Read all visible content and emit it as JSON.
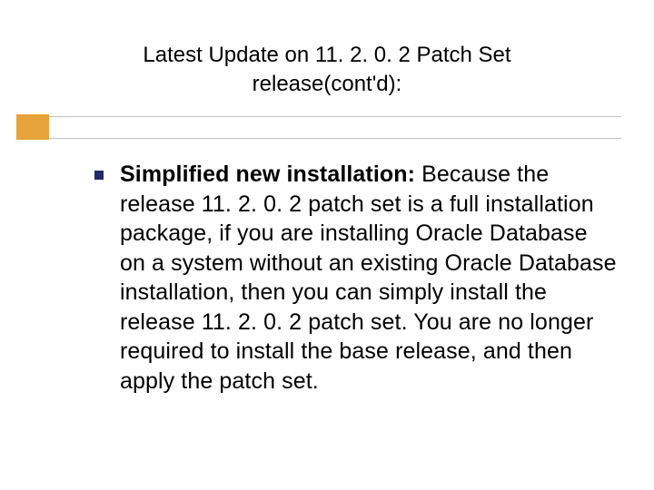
{
  "slide": {
    "title_line1": "Latest Update on 11. 2. 0. 2 Patch Set",
    "title_line2": "release(cont'd):",
    "bullet": {
      "bold": "Simplified new installation: ",
      "rest": "Because the release 11. 2. 0. 2 patch set is a full installation package, if you are installing Oracle Database on a system without an existing Oracle Database installation, then you can simply install the release 11. 2. 0. 2 patch set. You are no longer required to install the base release, and then apply the patch set."
    }
  }
}
